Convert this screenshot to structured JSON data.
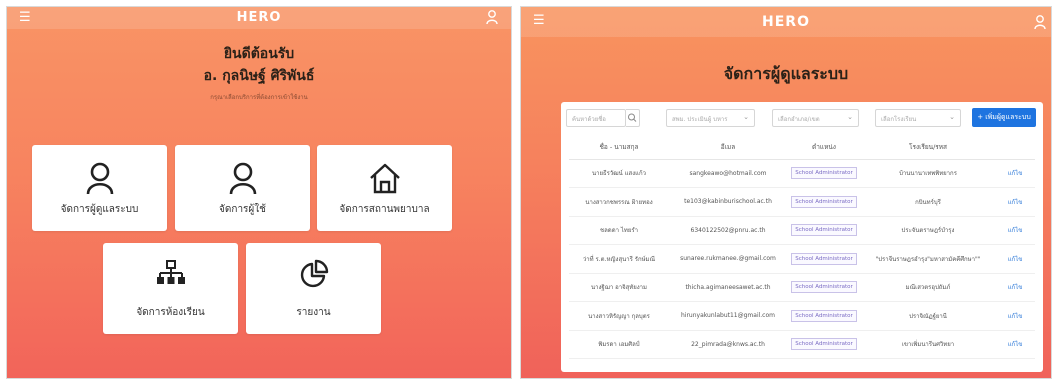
{
  "left": {
    "header": {
      "brand": "HERO",
      "menu_icon": "hamburger-menu-icon",
      "user_icon": "user-icon"
    },
    "welcome": "ยินดีต้อนรับ",
    "user_name": "อ. กุลนิษฐ์ ศิริพันธ์",
    "hint": "กรุณาเลือกบริการที่ต้องการเข้าใช้งาน",
    "menu": [
      {
        "label": "จัดการผู้ดูแลระบบ",
        "icon": "user-icon"
      },
      {
        "label": "จัดการผู้ใช้",
        "icon": "user-icon"
      },
      {
        "label": "จัดการสถานพยาบาล",
        "icon": "home-icon"
      },
      {
        "label": "จัดการห้องเรียน",
        "icon": "sitemap-icon"
      },
      {
        "label": "รายงาน",
        "icon": "pie-chart-icon"
      }
    ]
  },
  "right": {
    "header": {
      "brand": "HERO",
      "menu_icon": "hamburger-menu-icon",
      "user_icon": "user-icon"
    },
    "title": "จัดการผู้ดูแลระบบ",
    "filters": {
      "search_placeholder": "ค้นหาด้วยชื่อ",
      "position": "สพม. ประเมินผู้ บหาร",
      "district": "เลือกอำเภอ/เขต",
      "school": "เลือกโรงเรียน"
    },
    "add_button": "+ เพิ่มผู้ดูแลระบบ",
    "columns": [
      "ชื่อ - นามสกุล",
      "อีเมล",
      "ตำแหน่ง",
      "โรงเรียน/รหส",
      ""
    ],
    "rows": [
      {
        "name": "นายธีรวัฒน์ แสงแก้ว",
        "email": "sangkeawo@hotmail.com",
        "position": "School Administrator",
        "school": "บ้านนานาเทพพิทยากร",
        "action": "แก้ไข"
      },
      {
        "name": "นางสาวกชพรรณ ฝ้ายทอง",
        "email": "te103@kabinburischool.ac.th",
        "position": "School Administrator",
        "school": "กบินทร์บุรี",
        "action": "แก้ไข"
      },
      {
        "name": "ชลดดา ไทยรำ",
        "email": "6340122502@pnru.ac.th",
        "position": "School Administrator",
        "school": "ประจันตราษฎร์บำรุง",
        "action": "แก้ไข"
      },
      {
        "name": "ว่าที่ ร.ต.หญิงสุนารี รักษ์มณี",
        "email": "sunaree.rukmanee.@gmail.com",
        "position": "School Administrator",
        "school": "\"ปราจีนราษฎรอำรุง\"มหาสามัคคีศึกษา\"\"",
        "action": "แก้ไข"
      },
      {
        "name": "นางฐิฌา อาจิสุทัยงาม",
        "email": "thicha.agimaneesawet.ac.th",
        "position": "School Administrator",
        "school": "มณีเสวตรอุปถัมภ์",
        "action": "แก้ไข"
      },
      {
        "name": "นางสาวหิรัญญา กุลบุตร",
        "email": "hirunyakunlabut11@gmail.com",
        "position": "School Administrator",
        "school": "ปราจิณัฏฐ์ยานี",
        "action": "แก้ไข"
      },
      {
        "name": "พิมรดา เอมศิลป์",
        "email": "22_pimrada@knws.ac.th",
        "position": "School Administrator",
        "school": "เขาเพิ่มนารีนศวิทยา",
        "action": "แก้ไข"
      }
    ]
  }
}
